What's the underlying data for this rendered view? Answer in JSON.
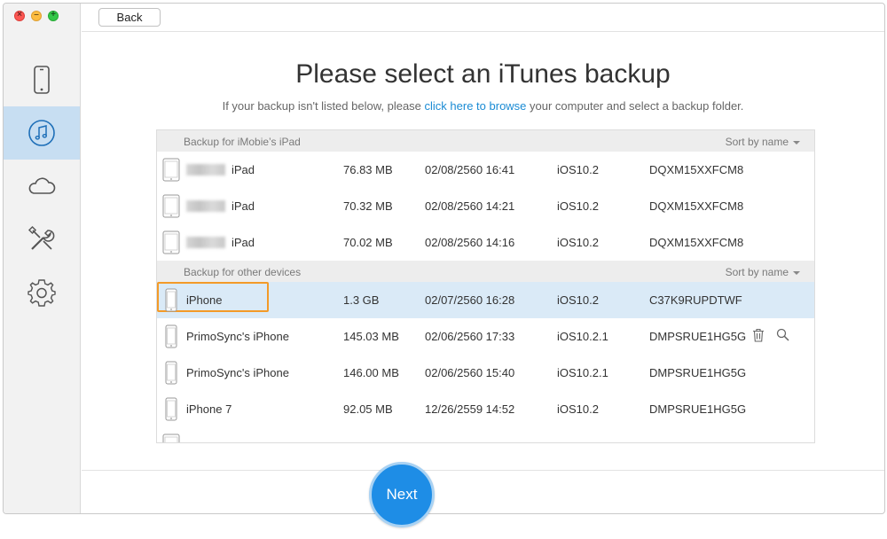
{
  "toolbar": {
    "back_label": "Back"
  },
  "sidebar": {
    "items": [
      {
        "icon": "phone-icon",
        "active": false
      },
      {
        "icon": "music-note-icon",
        "active": true
      },
      {
        "icon": "cloud-icon",
        "active": false
      },
      {
        "icon": "tools-icon",
        "active": false
      },
      {
        "icon": "gear-icon",
        "active": false
      }
    ]
  },
  "main": {
    "title": "Please select an iTunes backup",
    "subtitle_prefix": "If your backup isn't listed below, please ",
    "subtitle_link": "click here to browse",
    "subtitle_suffix": " your computer and select a backup folder."
  },
  "groups": [
    {
      "name": "Backup for iMobie’s iPad",
      "sort_label": "Sort by name",
      "rows": [
        {
          "name": "iPad",
          "size": "76.83 MB",
          "date": "02/08/2560 16:41",
          "ios": "iOS10.2",
          "serial": "DQXM15XXFCM8"
        },
        {
          "name": "iPad",
          "size": "70.32 MB",
          "date": "02/08/2560 14:21",
          "ios": "iOS10.2",
          "serial": "DQXM15XXFCM8"
        },
        {
          "name": "iPad",
          "size": "70.02 MB",
          "date": "02/08/2560 14:16",
          "ios": "iOS10.2",
          "serial": "DQXM15XXFCM8"
        }
      ]
    },
    {
      "name": "Backup for other devices",
      "sort_label": "Sort by name",
      "rows": [
        {
          "name": "iPhone",
          "size": "1.3 GB",
          "date": "02/07/2560 16:28",
          "ios": "iOS10.2",
          "serial": "C37K9RUPDTWF"
        },
        {
          "name": "PrimoSync's iPhone",
          "size": "145.03 MB",
          "date": "02/06/2560 17:33",
          "ios": "iOS10.2.1",
          "serial": "DMPSRUE1HG5G"
        },
        {
          "name": "PrimoSync's iPhone",
          "size": "146.00 MB",
          "date": "02/06/2560 15:40",
          "ios": "iOS10.2.1",
          "serial": "DMPSRUE1HG5G"
        },
        {
          "name": "iPhone 7",
          "size": "92.05 MB",
          "date": "12/26/2559 14:52",
          "ios": "iOS10.2",
          "serial": "DMPSRUE1HG5G"
        }
      ]
    }
  ],
  "next_label": "Next",
  "colors": {
    "accent": "#1e8de6",
    "link": "#1a8bd4",
    "selected_row": "#daeaf7",
    "highlight": "#f39a28"
  }
}
